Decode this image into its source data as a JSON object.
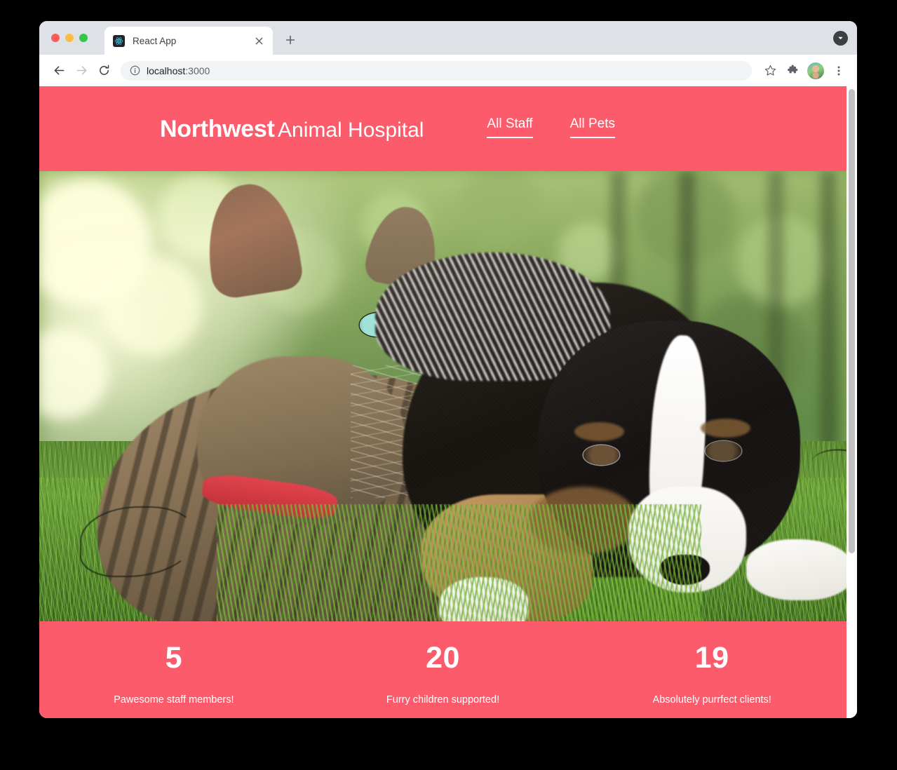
{
  "browser": {
    "tab": {
      "title": "React App",
      "favicon_icon": "react-logo-icon",
      "close_icon": "close-icon"
    },
    "new_tab_icon": "plus-icon",
    "tabstrip_right_icon": "chevron-down-circle-icon",
    "toolbar": {
      "back_icon": "back-arrow-icon",
      "forward_icon": "forward-arrow-icon",
      "reload_icon": "reload-icon",
      "info_icon": "info-circle-icon",
      "url_host": "localhost",
      "url_port": ":3000",
      "bookmark_icon": "star-icon",
      "extensions_icon": "puzzle-piece-icon",
      "avatar_icon": "profile-avatar-icon",
      "menu_icon": "three-dot-menu-icon"
    },
    "window_controls": {
      "close_label": "close",
      "minimize_label": "minimize",
      "maximize_label": "maximize"
    }
  },
  "site": {
    "brand": {
      "strong": "Northwest",
      "light": "Animal Hospital"
    },
    "nav": [
      {
        "label": "All Staff"
      },
      {
        "label": "All Pets"
      }
    ],
    "hero": {
      "alt": "A tabby cat with a red collar and a tri-color Australian Shepherd puppy lying together in sunlit grass"
    },
    "stats": [
      {
        "number": "5",
        "label": "Pawesome staff members!"
      },
      {
        "number": "20",
        "label": "Furry children supported!"
      },
      {
        "number": "19",
        "label": "Absolutely purrfect clients!"
      }
    ]
  },
  "colors": {
    "brand_pink": "#FB5B6B",
    "tabstrip_gray": "#DEE1E6",
    "omnibox_gray": "#F1F3F4",
    "text_dark": "#202124",
    "text_muted": "#5F6368",
    "traffic_red": "#FC5C57",
    "traffic_yellow": "#FDBC40",
    "traffic_green": "#33C748",
    "scrollbar_thumb": "#C1C1C1"
  }
}
